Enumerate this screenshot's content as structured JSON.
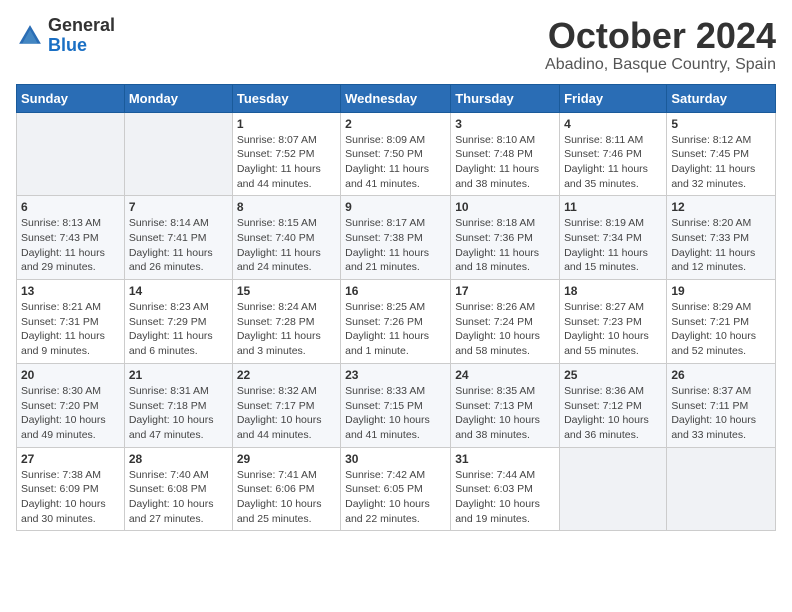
{
  "header": {
    "logo_general": "General",
    "logo_blue": "Blue",
    "month": "October 2024",
    "location": "Abadino, Basque Country, Spain"
  },
  "weekdays": [
    "Sunday",
    "Monday",
    "Tuesday",
    "Wednesday",
    "Thursday",
    "Friday",
    "Saturday"
  ],
  "weeks": [
    [
      {
        "day": "",
        "content": ""
      },
      {
        "day": "",
        "content": ""
      },
      {
        "day": "1",
        "content": "Sunrise: 8:07 AM\nSunset: 7:52 PM\nDaylight: 11 hours and 44 minutes."
      },
      {
        "day": "2",
        "content": "Sunrise: 8:09 AM\nSunset: 7:50 PM\nDaylight: 11 hours and 41 minutes."
      },
      {
        "day": "3",
        "content": "Sunrise: 8:10 AM\nSunset: 7:48 PM\nDaylight: 11 hours and 38 minutes."
      },
      {
        "day": "4",
        "content": "Sunrise: 8:11 AM\nSunset: 7:46 PM\nDaylight: 11 hours and 35 minutes."
      },
      {
        "day": "5",
        "content": "Sunrise: 8:12 AM\nSunset: 7:45 PM\nDaylight: 11 hours and 32 minutes."
      }
    ],
    [
      {
        "day": "6",
        "content": "Sunrise: 8:13 AM\nSunset: 7:43 PM\nDaylight: 11 hours and 29 minutes."
      },
      {
        "day": "7",
        "content": "Sunrise: 8:14 AM\nSunset: 7:41 PM\nDaylight: 11 hours and 26 minutes."
      },
      {
        "day": "8",
        "content": "Sunrise: 8:15 AM\nSunset: 7:40 PM\nDaylight: 11 hours and 24 minutes."
      },
      {
        "day": "9",
        "content": "Sunrise: 8:17 AM\nSunset: 7:38 PM\nDaylight: 11 hours and 21 minutes."
      },
      {
        "day": "10",
        "content": "Sunrise: 8:18 AM\nSunset: 7:36 PM\nDaylight: 11 hours and 18 minutes."
      },
      {
        "day": "11",
        "content": "Sunrise: 8:19 AM\nSunset: 7:34 PM\nDaylight: 11 hours and 15 minutes."
      },
      {
        "day": "12",
        "content": "Sunrise: 8:20 AM\nSunset: 7:33 PM\nDaylight: 11 hours and 12 minutes."
      }
    ],
    [
      {
        "day": "13",
        "content": "Sunrise: 8:21 AM\nSunset: 7:31 PM\nDaylight: 11 hours and 9 minutes."
      },
      {
        "day": "14",
        "content": "Sunrise: 8:23 AM\nSunset: 7:29 PM\nDaylight: 11 hours and 6 minutes."
      },
      {
        "day": "15",
        "content": "Sunrise: 8:24 AM\nSunset: 7:28 PM\nDaylight: 11 hours and 3 minutes."
      },
      {
        "day": "16",
        "content": "Sunrise: 8:25 AM\nSunset: 7:26 PM\nDaylight: 11 hours and 1 minute."
      },
      {
        "day": "17",
        "content": "Sunrise: 8:26 AM\nSunset: 7:24 PM\nDaylight: 10 hours and 58 minutes."
      },
      {
        "day": "18",
        "content": "Sunrise: 8:27 AM\nSunset: 7:23 PM\nDaylight: 10 hours and 55 minutes."
      },
      {
        "day": "19",
        "content": "Sunrise: 8:29 AM\nSunset: 7:21 PM\nDaylight: 10 hours and 52 minutes."
      }
    ],
    [
      {
        "day": "20",
        "content": "Sunrise: 8:30 AM\nSunset: 7:20 PM\nDaylight: 10 hours and 49 minutes."
      },
      {
        "day": "21",
        "content": "Sunrise: 8:31 AM\nSunset: 7:18 PM\nDaylight: 10 hours and 47 minutes."
      },
      {
        "day": "22",
        "content": "Sunrise: 8:32 AM\nSunset: 7:17 PM\nDaylight: 10 hours and 44 minutes."
      },
      {
        "day": "23",
        "content": "Sunrise: 8:33 AM\nSunset: 7:15 PM\nDaylight: 10 hours and 41 minutes."
      },
      {
        "day": "24",
        "content": "Sunrise: 8:35 AM\nSunset: 7:13 PM\nDaylight: 10 hours and 38 minutes."
      },
      {
        "day": "25",
        "content": "Sunrise: 8:36 AM\nSunset: 7:12 PM\nDaylight: 10 hours and 36 minutes."
      },
      {
        "day": "26",
        "content": "Sunrise: 8:37 AM\nSunset: 7:11 PM\nDaylight: 10 hours and 33 minutes."
      }
    ],
    [
      {
        "day": "27",
        "content": "Sunrise: 7:38 AM\nSunset: 6:09 PM\nDaylight: 10 hours and 30 minutes."
      },
      {
        "day": "28",
        "content": "Sunrise: 7:40 AM\nSunset: 6:08 PM\nDaylight: 10 hours and 27 minutes."
      },
      {
        "day": "29",
        "content": "Sunrise: 7:41 AM\nSunset: 6:06 PM\nDaylight: 10 hours and 25 minutes."
      },
      {
        "day": "30",
        "content": "Sunrise: 7:42 AM\nSunset: 6:05 PM\nDaylight: 10 hours and 22 minutes."
      },
      {
        "day": "31",
        "content": "Sunrise: 7:44 AM\nSunset: 6:03 PM\nDaylight: 10 hours and 19 minutes."
      },
      {
        "day": "",
        "content": ""
      },
      {
        "day": "",
        "content": ""
      }
    ]
  ]
}
